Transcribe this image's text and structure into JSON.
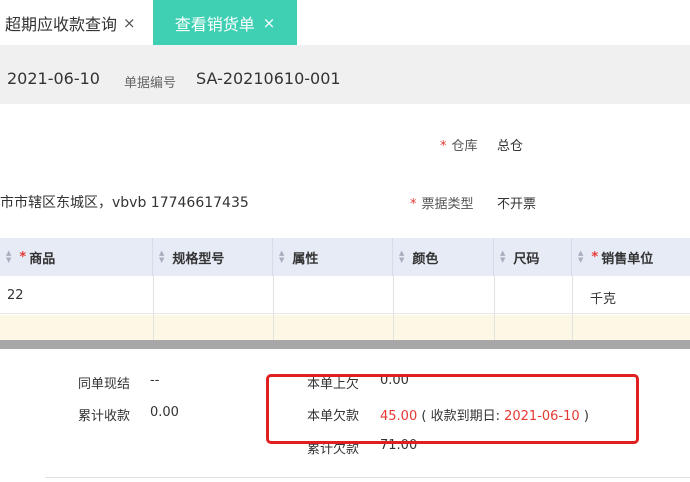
{
  "tabs": [
    {
      "label": "超期应收款查询",
      "close": "×"
    },
    {
      "label": "查看销货单",
      "close": "×"
    }
  ],
  "header": {
    "date": "2021-06-10",
    "bill_no_label": "单据编号",
    "bill_no": "SA-20210610-001"
  },
  "form": {
    "required_mark": "*",
    "warehouse_label": "仓库",
    "warehouse_value": "总仓",
    "address": "市市辖区东城区，vbvb 17746617435",
    "invoice_type_label": "票据类型",
    "invoice_type_value": "不开票"
  },
  "table": {
    "columns": [
      {
        "label": "商品",
        "required": true
      },
      {
        "label": "规格型号",
        "required": false
      },
      {
        "label": "属性",
        "required": false
      },
      {
        "label": "颜色",
        "required": false
      },
      {
        "label": "尺码",
        "required": false
      },
      {
        "label": "销售单位",
        "required": true
      }
    ],
    "rows": [
      {
        "product": "22",
        "spec": "",
        "attr": "",
        "color": "",
        "size": "",
        "unit": "千克"
      }
    ]
  },
  "summary": {
    "same_bill_cash_label": "同单现结",
    "same_bill_cash_value": "--",
    "total_received_label": "累计收款",
    "total_received_value": "0.00",
    "current_upper_label": "本单上欠",
    "current_upper_value": "0.00",
    "owed_label": "本单欠款",
    "owed_value": "45.00",
    "due_paren_open": "(",
    "due_label": "收款到期日:",
    "due_date": "2021-06-10",
    "due_paren_close": ")",
    "total_owed_label": "累计欠款",
    "total_owed_value": "71.00"
  },
  "colors": {
    "accent": "#3fcfb3",
    "required": "#e53935",
    "highlight_box": "#e02020"
  }
}
